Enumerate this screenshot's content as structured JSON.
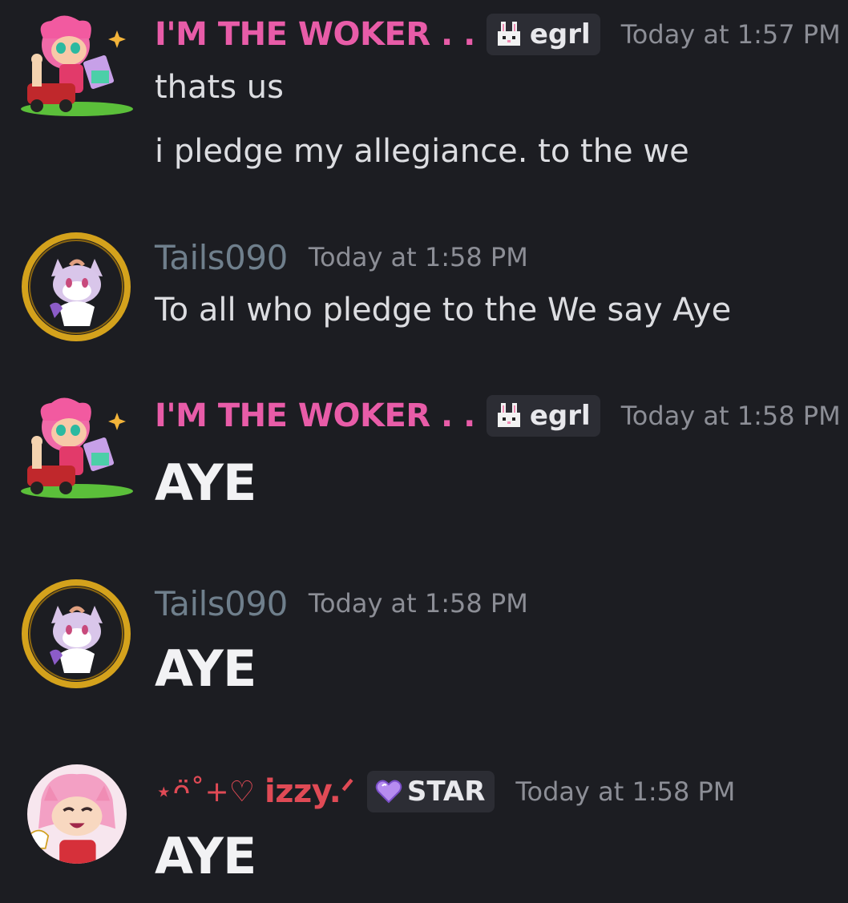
{
  "messages": [
    {
      "author": "I'M THE WOKER . .",
      "tag_label": "egrl",
      "tag_icon": "bunny-icon",
      "timestamp": "Today at 1:57 PM",
      "lines": [
        "thats us",
        "i pledge my allegiance. to the we"
      ]
    },
    {
      "author": "Tails090",
      "timestamp": "Today at 1:58 PM",
      "lines": [
        "To all who pledge to the We say Aye"
      ]
    },
    {
      "author": "I'M THE WOKER . .",
      "tag_label": "egrl",
      "tag_icon": "bunny-icon",
      "timestamp": "Today at 1:58 PM",
      "lines": [
        "AYE"
      ]
    },
    {
      "author": "Tails090",
      "timestamp": "Today at 1:58 PM",
      "lines": [
        "AYE"
      ]
    },
    {
      "author_decoration": "⋆ᴖ̈˚+♡",
      "author": "izzy.ᐟ",
      "tag_label": "STAR",
      "tag_icon": "purple-heart-icon",
      "timestamp": "Today at 1:58 PM",
      "lines": [
        "AYE"
      ]
    }
  ],
  "colors": {
    "background": "#1c1d22",
    "woker_name": "#e85ca8",
    "tails_name": "#6f7f8c",
    "izzy_name": "#e04a55",
    "timestamp": "#8c8e96"
  }
}
